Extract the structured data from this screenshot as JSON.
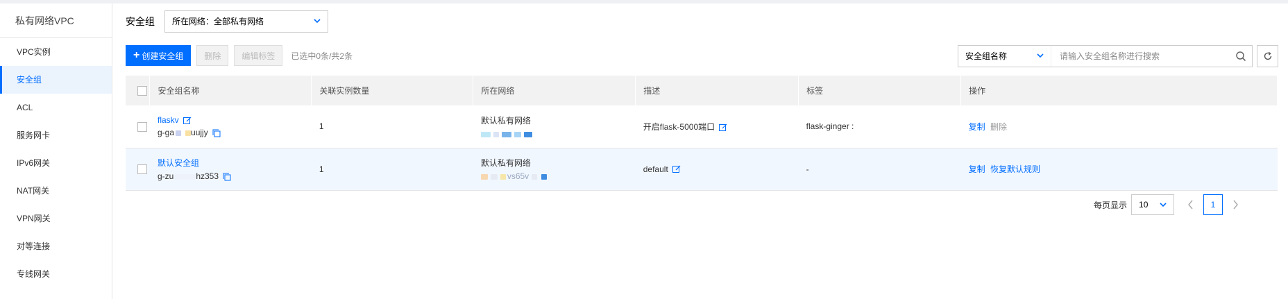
{
  "sidebar": {
    "title": "私有网络VPC",
    "items": [
      {
        "label": "VPC实例"
      },
      {
        "label": "安全组"
      },
      {
        "label": "ACL"
      },
      {
        "label": "服务网卡"
      },
      {
        "label": "IPv6网关"
      },
      {
        "label": "NAT网关"
      },
      {
        "label": "VPN网关"
      },
      {
        "label": "对等连接"
      },
      {
        "label": "专线网关"
      }
    ],
    "active_index": 1
  },
  "header": {
    "title": "安全组",
    "network_select": "所在网络：全部私有网络"
  },
  "toolbar": {
    "create_label": "创建安全组",
    "delete_label": "删除",
    "edit_tags_label": "编辑标签",
    "selection_count": "已选中0条/共2条"
  },
  "search": {
    "field_select": "安全组名称",
    "placeholder": "请输入安全组名称进行搜索"
  },
  "table": {
    "columns": [
      "安全组名称",
      "关联实例数量",
      "所在网络",
      "描述",
      "标签",
      "操作"
    ],
    "rows": [
      {
        "name": "flaskv",
        "id": "g-ga",
        "id_suffix": "uujjy",
        "instance_count": "1",
        "network": "默认私有网络",
        "description": "开启flask-5000端口",
        "tags": "flask-ginger :",
        "actions": [
          "复制",
          "删除"
        ]
      },
      {
        "name": "默认安全组",
        "id": "g-zu",
        "id_suffix": "hz353",
        "instance_count": "1",
        "network": "默认私有网络",
        "network_id_fragment": "vs65v",
        "description": "default",
        "tags": "-",
        "actions": [
          "复制",
          "恢复默认规则"
        ]
      }
    ]
  },
  "pagination": {
    "label": "每页显示",
    "page_size": "10",
    "current_page": "1"
  },
  "colors": {
    "accent": "#006eff",
    "active_bg": "#ebf3fd",
    "header_bg": "#f2f2f2",
    "row_highlight": "#f1f7ff"
  }
}
